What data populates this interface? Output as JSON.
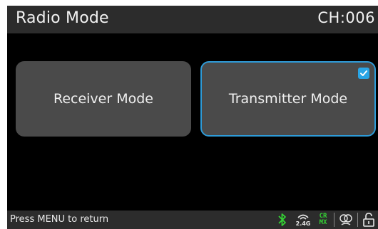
{
  "header": {
    "title": "Radio Mode",
    "channel": "CH:006"
  },
  "modes": [
    {
      "label": "Receiver Mode",
      "selected": false
    },
    {
      "label": "Transmitter Mode",
      "selected": true
    }
  ],
  "footer": {
    "hint": "Press MENU to return",
    "wifi_band": "2.4G",
    "crmx_top": "CR",
    "crmx_bottom": "MX",
    "icons": [
      "bluetooth-icon",
      "wifi-2.4g-icon",
      "crmx-icon",
      "dmx-link-icon",
      "lock-open-icon"
    ]
  },
  "colors": {
    "accent": "#2e9bd8",
    "crmx": "#35d235",
    "bluetooth": "#35d235"
  }
}
